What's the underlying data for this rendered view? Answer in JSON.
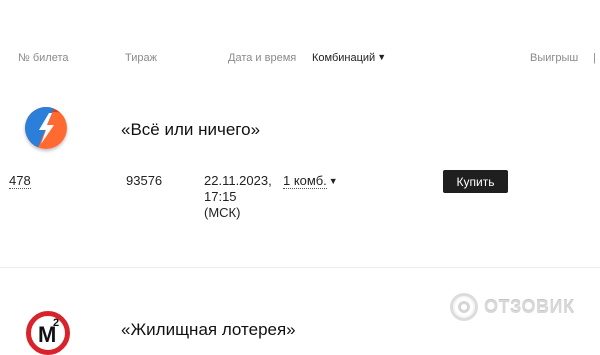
{
  "columns": {
    "ticket": "№ билета",
    "draw": "Тираж",
    "datetime": "Дата и время",
    "combinations": "Комбинаций",
    "prize": "Выигрыш"
  },
  "games": [
    {
      "title": "«Всё или ничего»",
      "logo_icon": "lightning-ball-icon",
      "row": {
        "ticket": "478",
        "draw": "93576",
        "date": "22.11.2023,",
        "time": "17:15",
        "tz": "(МСК)",
        "combinations": "1 комб.",
        "buy_label": "Купить"
      }
    },
    {
      "title": "«Жилищная лотерея»",
      "logo_icon": "m2-logo-icon",
      "logo_m": "M",
      "logo_sup": "2"
    }
  ],
  "watermark": {
    "text": "ОТЗОВИК"
  },
  "colors": {
    "button_bg": "#1f1f1f",
    "logo_red": "#d8232a",
    "logo_blue": "#2c7fd9",
    "logo_orange": "#ff6a33"
  }
}
